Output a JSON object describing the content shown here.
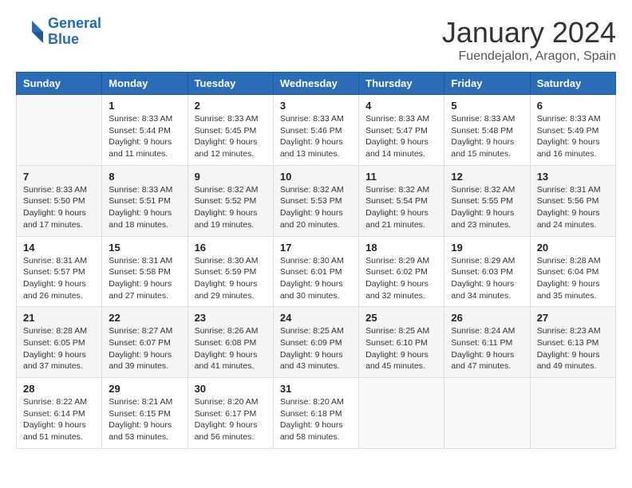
{
  "logo": {
    "line1": "General",
    "line2": "Blue"
  },
  "title": "January 2024",
  "location": "Fuendejalon, Aragon, Spain",
  "weekdays": [
    "Sunday",
    "Monday",
    "Tuesday",
    "Wednesday",
    "Thursday",
    "Friday",
    "Saturday"
  ],
  "weeks": [
    [
      {
        "day": "",
        "info": ""
      },
      {
        "day": "1",
        "info": "Sunrise: 8:33 AM\nSunset: 5:44 PM\nDaylight: 9 hours\nand 11 minutes."
      },
      {
        "day": "2",
        "info": "Sunrise: 8:33 AM\nSunset: 5:45 PM\nDaylight: 9 hours\nand 12 minutes."
      },
      {
        "day": "3",
        "info": "Sunrise: 8:33 AM\nSunset: 5:46 PM\nDaylight: 9 hours\nand 13 minutes."
      },
      {
        "day": "4",
        "info": "Sunrise: 8:33 AM\nSunset: 5:47 PM\nDaylight: 9 hours\nand 14 minutes."
      },
      {
        "day": "5",
        "info": "Sunrise: 8:33 AM\nSunset: 5:48 PM\nDaylight: 9 hours\nand 15 minutes."
      },
      {
        "day": "6",
        "info": "Sunrise: 8:33 AM\nSunset: 5:49 PM\nDaylight: 9 hours\nand 16 minutes."
      }
    ],
    [
      {
        "day": "7",
        "info": "Sunrise: 8:33 AM\nSunset: 5:50 PM\nDaylight: 9 hours\nand 17 minutes."
      },
      {
        "day": "8",
        "info": "Sunrise: 8:33 AM\nSunset: 5:51 PM\nDaylight: 9 hours\nand 18 minutes."
      },
      {
        "day": "9",
        "info": "Sunrise: 8:32 AM\nSunset: 5:52 PM\nDaylight: 9 hours\nand 19 minutes."
      },
      {
        "day": "10",
        "info": "Sunrise: 8:32 AM\nSunset: 5:53 PM\nDaylight: 9 hours\nand 20 minutes."
      },
      {
        "day": "11",
        "info": "Sunrise: 8:32 AM\nSunset: 5:54 PM\nDaylight: 9 hours\nand 21 minutes."
      },
      {
        "day": "12",
        "info": "Sunrise: 8:32 AM\nSunset: 5:55 PM\nDaylight: 9 hours\nand 23 minutes."
      },
      {
        "day": "13",
        "info": "Sunrise: 8:31 AM\nSunset: 5:56 PM\nDaylight: 9 hours\nand 24 minutes."
      }
    ],
    [
      {
        "day": "14",
        "info": "Sunrise: 8:31 AM\nSunset: 5:57 PM\nDaylight: 9 hours\nand 26 minutes."
      },
      {
        "day": "15",
        "info": "Sunrise: 8:31 AM\nSunset: 5:58 PM\nDaylight: 9 hours\nand 27 minutes."
      },
      {
        "day": "16",
        "info": "Sunrise: 8:30 AM\nSunset: 5:59 PM\nDaylight: 9 hours\nand 29 minutes."
      },
      {
        "day": "17",
        "info": "Sunrise: 8:30 AM\nSunset: 6:01 PM\nDaylight: 9 hours\nand 30 minutes."
      },
      {
        "day": "18",
        "info": "Sunrise: 8:29 AM\nSunset: 6:02 PM\nDaylight: 9 hours\nand 32 minutes."
      },
      {
        "day": "19",
        "info": "Sunrise: 8:29 AM\nSunset: 6:03 PM\nDaylight: 9 hours\nand 34 minutes."
      },
      {
        "day": "20",
        "info": "Sunrise: 8:28 AM\nSunset: 6:04 PM\nDaylight: 9 hours\nand 35 minutes."
      }
    ],
    [
      {
        "day": "21",
        "info": "Sunrise: 8:28 AM\nSunset: 6:05 PM\nDaylight: 9 hours\nand 37 minutes."
      },
      {
        "day": "22",
        "info": "Sunrise: 8:27 AM\nSunset: 6:07 PM\nDaylight: 9 hours\nand 39 minutes."
      },
      {
        "day": "23",
        "info": "Sunrise: 8:26 AM\nSunset: 6:08 PM\nDaylight: 9 hours\nand 41 minutes."
      },
      {
        "day": "24",
        "info": "Sunrise: 8:25 AM\nSunset: 6:09 PM\nDaylight: 9 hours\nand 43 minutes."
      },
      {
        "day": "25",
        "info": "Sunrise: 8:25 AM\nSunset: 6:10 PM\nDaylight: 9 hours\nand 45 minutes."
      },
      {
        "day": "26",
        "info": "Sunrise: 8:24 AM\nSunset: 6:11 PM\nDaylight: 9 hours\nand 47 minutes."
      },
      {
        "day": "27",
        "info": "Sunrise: 8:23 AM\nSunset: 6:13 PM\nDaylight: 9 hours\nand 49 minutes."
      }
    ],
    [
      {
        "day": "28",
        "info": "Sunrise: 8:22 AM\nSunset: 6:14 PM\nDaylight: 9 hours\nand 51 minutes."
      },
      {
        "day": "29",
        "info": "Sunrise: 8:21 AM\nSunset: 6:15 PM\nDaylight: 9 hours\nand 53 minutes."
      },
      {
        "day": "30",
        "info": "Sunrise: 8:20 AM\nSunset: 6:17 PM\nDaylight: 9 hours\nand 56 minutes."
      },
      {
        "day": "31",
        "info": "Sunrise: 8:20 AM\nSunset: 6:18 PM\nDaylight: 9 hours\nand 58 minutes."
      },
      {
        "day": "",
        "info": ""
      },
      {
        "day": "",
        "info": ""
      },
      {
        "day": "",
        "info": ""
      }
    ]
  ]
}
